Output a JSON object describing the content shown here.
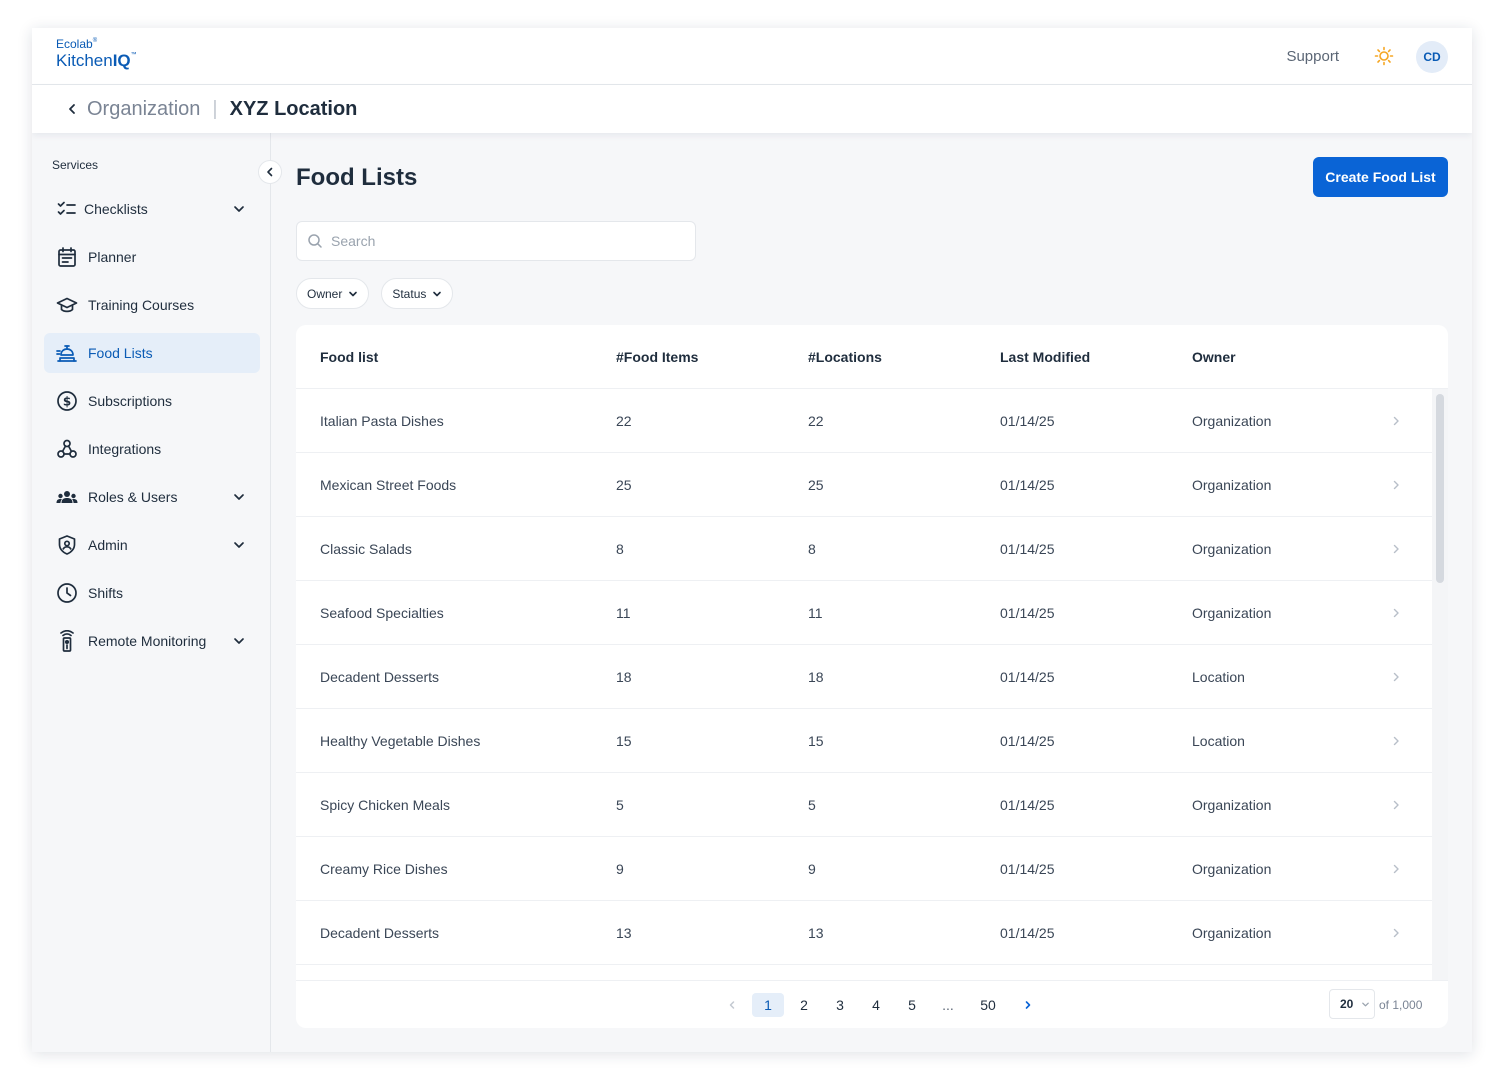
{
  "header": {
    "logo_top": "Ecolab",
    "logo_kitchen": "Kitchen",
    "logo_iq": "IQ",
    "support_label": "Support",
    "theme_icon": "sun-icon",
    "avatar_initials": "CD"
  },
  "breadcrumb": {
    "back_icon": "chevron-left-icon",
    "parent": "Organization",
    "separator": "|",
    "current": "XYZ Location"
  },
  "sidebar": {
    "section_label": "Services",
    "items": [
      {
        "label": "Checklists",
        "icon": "checklist-icon",
        "expandable": true
      },
      {
        "label": "Planner",
        "icon": "calendar-icon",
        "expandable": false
      },
      {
        "label": "Training Courses",
        "icon": "graduation-cap-icon",
        "expandable": false
      },
      {
        "label": "Food Lists",
        "icon": "food-tray-icon",
        "expandable": false,
        "active": true
      },
      {
        "label": "Subscriptions",
        "icon": "dollar-circle-icon",
        "expandable": false
      },
      {
        "label": "Integrations",
        "icon": "webhook-icon",
        "expandable": false
      },
      {
        "label": "Roles & Users",
        "icon": "users-icon",
        "expandable": true
      },
      {
        "label": "Admin",
        "icon": "shield-icon",
        "expandable": true
      },
      {
        "label": "Shifts",
        "icon": "clock-icon",
        "expandable": false
      },
      {
        "label": "Remote Monitoring",
        "icon": "sensor-icon",
        "expandable": true
      }
    ]
  },
  "main": {
    "title": "Food Lists",
    "create_label": "Create Food List",
    "search_placeholder": "Search",
    "filters": [
      "Owner",
      "Status"
    ]
  },
  "table": {
    "columns": [
      "Food list",
      "#Food Items",
      "#Locations",
      "Last Modified",
      "Owner"
    ],
    "rows": [
      [
        "Italian Pasta Dishes",
        "22",
        "22",
        "01/14/25",
        "Organization"
      ],
      [
        "Mexican Street Foods",
        "25",
        "25",
        "01/14/25",
        "Organization"
      ],
      [
        "Classic Salads",
        "8",
        "8",
        "01/14/25",
        "Organization"
      ],
      [
        "Seafood Specialties",
        "11",
        "11",
        "01/14/25",
        "Organization"
      ],
      [
        "Decadent Desserts",
        "18",
        "18",
        "01/14/25",
        "Location"
      ],
      [
        "Healthy Vegetable Dishes",
        "15",
        "15",
        "01/14/25",
        "Location"
      ],
      [
        "Spicy Chicken Meals",
        "5",
        "5",
        "01/14/25",
        "Organization"
      ],
      [
        "Creamy Rice Dishes",
        "9",
        "9",
        "01/14/25",
        "Organization"
      ],
      [
        "Decadent Desserts",
        "13",
        "13",
        "01/14/25",
        "Organization"
      ]
    ]
  },
  "pagination": {
    "pages": [
      "1",
      "2",
      "3",
      "4",
      "5",
      "...",
      "50"
    ],
    "current_page": "1",
    "per_page": "20",
    "total_label": "of 1,000"
  },
  "colors": {
    "accent": "#0a64d6",
    "active_bg": "#e5eef9",
    "sun": "#f5a623"
  }
}
